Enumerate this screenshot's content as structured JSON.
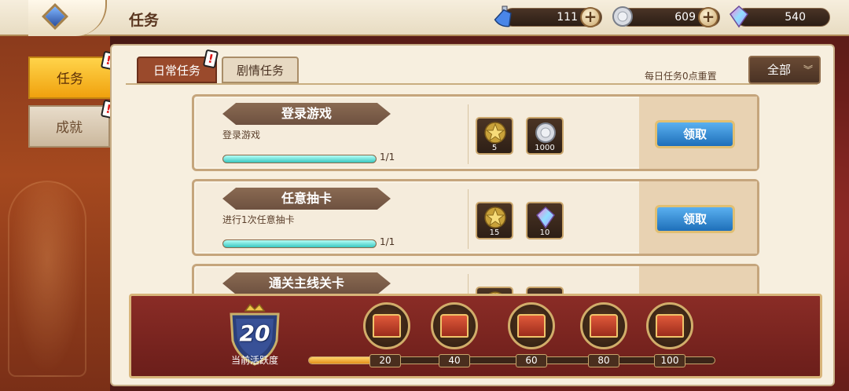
{
  "header": {
    "title": "任务",
    "resources": [
      {
        "name": "stamina-potion",
        "value": "111"
      },
      {
        "name": "silver-coin",
        "value": "609"
      },
      {
        "name": "rainbow-crystal",
        "value": "540"
      }
    ]
  },
  "side_tabs": [
    {
      "label": "任务",
      "active": true
    },
    {
      "label": "成就",
      "active": false
    }
  ],
  "category_tabs": [
    {
      "label": "日常任务",
      "active": true
    },
    {
      "label": "剧情任务",
      "active": false
    }
  ],
  "reset_note": "每日任务0点重置",
  "filter": {
    "label": "全部"
  },
  "tasks": [
    {
      "name": "登录游戏",
      "desc": "登录游戏",
      "progress_text": "1/1",
      "progress": 1.0,
      "rewards": [
        {
          "icon": "gold-star-medal",
          "count": "5"
        },
        {
          "icon": "silver-coin",
          "count": "1000"
        }
      ],
      "claim_label": "领取"
    },
    {
      "name": "任意抽卡",
      "desc": "进行1次任意抽卡",
      "progress_text": "1/1",
      "progress": 1.0,
      "rewards": [
        {
          "icon": "gold-star-medal",
          "count": "15"
        },
        {
          "icon": "rainbow-crystal",
          "count": "10"
        }
      ],
      "claim_label": "领取"
    },
    {
      "name": "通关主线关卡",
      "desc": "",
      "rewards": [
        {
          "icon": "gold-star-medal",
          "count": ""
        },
        {
          "icon": "treasure-item",
          "count": ""
        }
      ]
    }
  ],
  "activity": {
    "current": "20",
    "label": "当前活跃度",
    "progress": 0.2,
    "milestones": [
      "20",
      "40",
      "60",
      "80",
      "100"
    ]
  },
  "colors": {
    "claim_button": "#1e6fb9",
    "active_tab": "#9a4a2c",
    "side_tab_active": "#f0a10e",
    "progress_fill": "#39c7c0"
  }
}
